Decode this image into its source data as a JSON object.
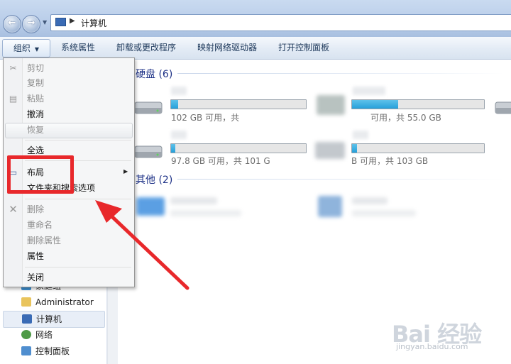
{
  "address": {
    "path_label": "计算机"
  },
  "toolbar": {
    "organize_label": "组织",
    "system_props_label": "系统属性",
    "uninstall_label": "卸载或更改程序",
    "map_drive_label": "映射网络驱动器",
    "control_panel_label": "打开控制面板"
  },
  "menu": {
    "cut": "剪切",
    "copy": "复制",
    "paste": "粘贴",
    "undo": "撤消",
    "redo": "恢复",
    "select_all": "全选",
    "layout": "布局",
    "folder_options": "文件夹和搜索选项",
    "delete": "删除",
    "rename": "重命名",
    "remove_props": "删除属性",
    "properties": "属性",
    "close": "关闭"
  },
  "nav": {
    "items": [
      {
        "label": "家庭组",
        "icon": "homegroup-icon"
      },
      {
        "label": "Administrator",
        "icon": "user-folder-icon"
      },
      {
        "label": "计算机",
        "icon": "computer-icon"
      },
      {
        "label": "网络",
        "icon": "network-icon"
      },
      {
        "label": "控制面板",
        "icon": "control-panel-icon"
      }
    ]
  },
  "content": {
    "hard_drives_header": "硬盘 (6)",
    "other_header": "其他 (2)",
    "drives": [
      {
        "size_text": "102 GB 可用，共",
        "fill_fraction": 0.05
      },
      {
        "size_text": "可用，共 55.0 GB",
        "fill_fraction": 0.35
      },
      {
        "size_text": "97.8 GB 可用，共 101 G",
        "fill_fraction": 0.03
      },
      {
        "size_text": "B 可用，共 103 GB",
        "fill_fraction": 0.04
      }
    ]
  },
  "watermark": {
    "logo": "Bai 经验",
    "url": "jingyan.baidu.com"
  },
  "colors": {
    "annotation_red": "#e8282b",
    "bar_fill": "#26a0da",
    "header_blue": "#1e3287"
  }
}
